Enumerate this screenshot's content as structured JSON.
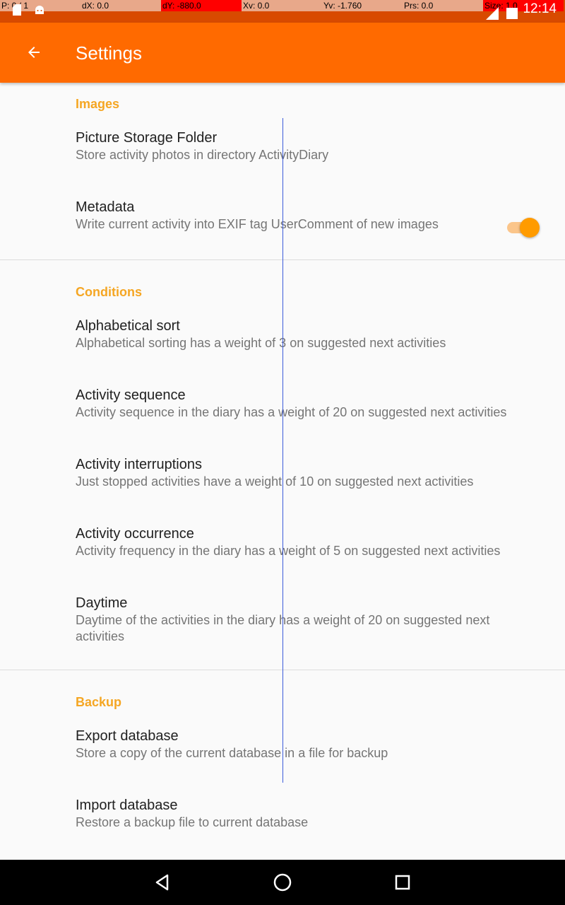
{
  "status_overlay": {
    "p": "P: 0 / 1",
    "dx": "dX: 0.0",
    "dy": "dY: -880.0",
    "xv": "Xv: 0.0",
    "yv": "Yv: -1.760",
    "prs": "Prs: 0.0",
    "size": "Size: 1.0"
  },
  "status_bar": {
    "time": "12:14"
  },
  "app_bar": {
    "title": "Settings",
    "back_icon": "arrow-back-icon"
  },
  "sections": [
    {
      "header": "Images",
      "items": [
        {
          "title": "Picture Storage Folder",
          "summary": "Store activity photos in directory ActivityDiary"
        },
        {
          "title": "Metadata",
          "summary": "Write current activity into EXIF tag UserComment of new images",
          "toggle_on": true
        }
      ]
    },
    {
      "header": "Conditions",
      "items": [
        {
          "title": "Alphabetical sort",
          "summary": "Alphabetical sorting has a weight of 3 on suggested next activities"
        },
        {
          "title": "Activity sequence",
          "summary": "Activity sequence in the diary has a weight of 20 on suggested next activities"
        },
        {
          "title": "Activity interruptions",
          "summary": "Just stopped activities have a weight of 10 on suggested next activities"
        },
        {
          "title": "Activity occurrence",
          "summary": "Activity frequency in the diary has a weight of 5 on suggested next activities"
        },
        {
          "title": "Daytime",
          "summary": "Daytime of the activities in the diary has a weight of 20 on suggested next activities"
        }
      ]
    },
    {
      "header": "Backup",
      "items": [
        {
          "title": "Export database",
          "summary": "Store a copy of the current database in a file for backup"
        },
        {
          "title": "Import database",
          "summary": "Restore a backup file to current database"
        }
      ]
    }
  ],
  "colors": {
    "app_bar": "#ff6a00",
    "status_bar": "#d84a00",
    "accent": "#f5a623",
    "toggle_thumb": "#ff9b00"
  },
  "nav_bar": {
    "icons": [
      "back-triangle-icon",
      "home-circle-icon",
      "recents-square-icon"
    ]
  }
}
